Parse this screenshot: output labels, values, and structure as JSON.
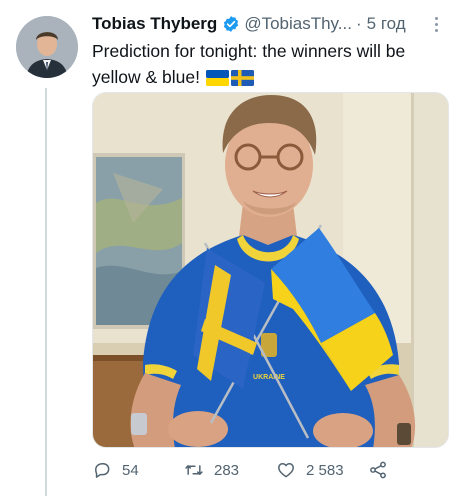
{
  "tweet": {
    "author_name": "Tobias Thyberg",
    "handle": "@TobiasThy...",
    "separator": "·",
    "time": "5 год",
    "text": "Prediction for tonight: the winners will be yellow & blue!",
    "flag_emoji": "ukraine-flag-icon, sweden-flag-icon"
  },
  "media": {
    "shirt_text": "UKRAINE"
  },
  "actions": {
    "replies": "54",
    "retweets": "283",
    "likes": "2 583"
  },
  "colors": {
    "verified": "#1d9bf0",
    "ukraine_blue": "#0057b7",
    "ukraine_yellow": "#ffd700",
    "sweden_blue": "#1d5bb6",
    "sweden_yellow": "#f2c21b",
    "muted_text": "#536471"
  }
}
